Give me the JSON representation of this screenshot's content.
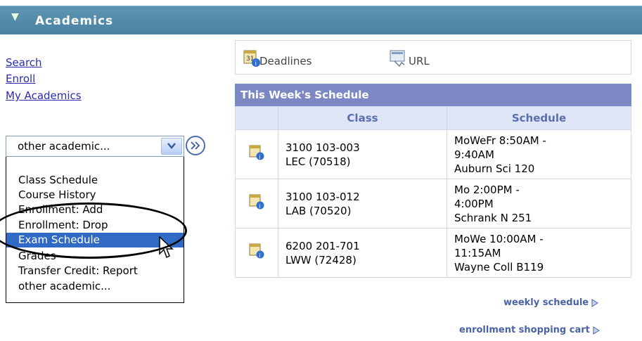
{
  "header": {
    "title": "Academics"
  },
  "nav": {
    "search": "Search",
    "enroll": "Enroll",
    "my_academics": "My Academics"
  },
  "dropdown": {
    "selected": "other academic...",
    "options": [
      "Class Schedule",
      "Course History",
      "Enrollment: Add",
      "Enrollment: Drop",
      "Exam Schedule",
      "Grades",
      "Transfer Credit: Report",
      "other academic..."
    ],
    "highlighted": "Exam Schedule"
  },
  "toolbar": {
    "deadlines": "Deadlines",
    "url": "URL"
  },
  "schedule": {
    "title": "This Week's Schedule",
    "columns": [
      "Class",
      "Schedule"
    ],
    "rows": [
      {
        "class_line1": "3100 103-003",
        "class_line2": "LEC (70518)",
        "sched_line1": "MoWeFr 8:50AM -",
        "sched_line2": "9:40AM",
        "sched_line3": "Auburn Sci 120"
      },
      {
        "class_line1": "3100 103-012",
        "class_line2": "LAB (70520)",
        "sched_line1": "Mo 2:00PM -",
        "sched_line2": "4:00PM",
        "sched_line3": "Schrank N 251"
      },
      {
        "class_line1": "6200 201-701",
        "class_line2": "LWW (72428)",
        "sched_line1": "MoWe 10:00AM -",
        "sched_line2": "11:15AM",
        "sched_line3": "Wayne Coll B119"
      }
    ]
  },
  "links": {
    "weekly": "weekly schedule",
    "cart": "enrollment shopping cart"
  },
  "colors": {
    "header": "#5083a3",
    "accent": "#7c88c4",
    "selection": "#316ac5"
  }
}
